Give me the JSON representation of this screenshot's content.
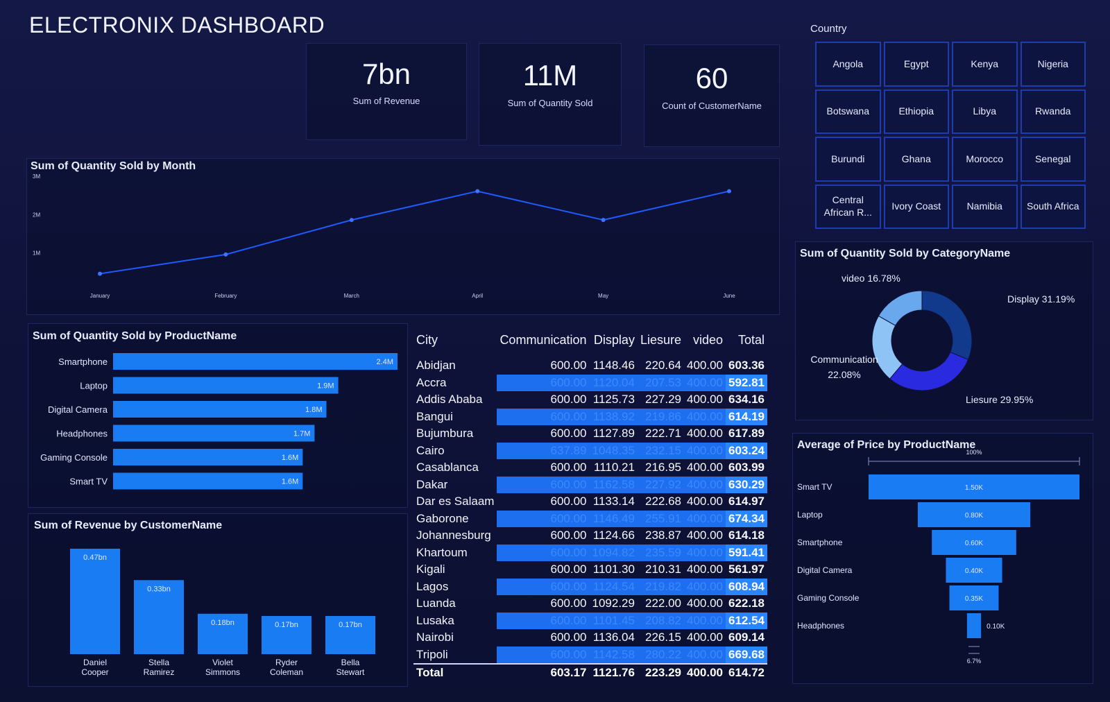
{
  "page": {
    "title": "ELECTRONIX DASHBOARD"
  },
  "kpis": [
    {
      "value": "7bn",
      "label": "Sum of Revenue"
    },
    {
      "value": "11M",
      "label": "Sum of Quantity Sold"
    },
    {
      "value": "60",
      "label": "Count of CustomerName"
    }
  ],
  "country_slicer": {
    "label": "Country",
    "items": [
      "Angola",
      "Egypt",
      "Kenya",
      "Nigeria",
      "Botswana",
      "Ethiopia",
      "Libya",
      "Rwanda",
      "Burundi",
      "Ghana",
      "Morocco",
      "Senegal",
      "Central African R...",
      "Ivory Coast",
      "Namibia",
      "South Africa"
    ]
  },
  "colors": {
    "accent": "#1e6ff0",
    "bar": "#1a7cf2",
    "line": "#1f5bff",
    "background": "#0e1238"
  },
  "line_chart": {
    "title": "Sum of Quantity Sold by Month",
    "chart_data": {
      "type": "line",
      "x": [
        "January",
        "February",
        "March",
        "April",
        "May",
        "June"
      ],
      "values": [
        0.55,
        1.05,
        1.95,
        2.7,
        1.95,
        2.7
      ],
      "ylim": [
        0,
        3
      ],
      "yticks": [
        "3M",
        "2M",
        "1M"
      ]
    }
  },
  "product_qty_chart": {
    "title": "Sum of Quantity Sold by ProductName",
    "chart_data": {
      "type": "bar",
      "categories": [
        "Smartphone",
        "Laptop",
        "Digital Camera",
        "Headphones",
        "Gaming Console",
        "Smart TV"
      ],
      "values": [
        2.4,
        1.9,
        1.8,
        1.7,
        1.6,
        1.6
      ],
      "labels": [
        "2.4M",
        "1.9M",
        "1.8M",
        "1.7M",
        "1.6M",
        "1.6M"
      ]
    }
  },
  "revenue_customer_chart": {
    "title": "Sum of Revenue by CustomerName",
    "chart_data": {
      "type": "bar",
      "categories": [
        "Daniel Cooper",
        "Stella Ramirez",
        "Violet Simmons",
        "Ryder Coleman",
        "Bella Stewart"
      ],
      "values": [
        0.47,
        0.33,
        0.18,
        0.17,
        0.17
      ],
      "labels": [
        "0.47bn",
        "0.33bn",
        "0.18bn",
        "0.17bn",
        "0.17bn"
      ]
    }
  },
  "table": {
    "headers": [
      "City",
      "Communication",
      "Display",
      "Liesure",
      "video",
      "Total"
    ],
    "rows": [
      [
        "Abidjan",
        "600.00",
        "1148.46",
        "220.64",
        "400.00",
        "603.36"
      ],
      [
        "Accra",
        "600.00",
        "1120.04",
        "207.53",
        "400.00",
        "592.81"
      ],
      [
        "Addis Ababa",
        "600.00",
        "1125.73",
        "227.29",
        "400.00",
        "634.16"
      ],
      [
        "Bangui",
        "600.00",
        "1138.92",
        "219.86",
        "400.00",
        "614.19"
      ],
      [
        "Bujumbura",
        "600.00",
        "1127.89",
        "222.71",
        "400.00",
        "617.89"
      ],
      [
        "Cairo",
        "637.89",
        "1048.35",
        "232.15",
        "400.00",
        "603.24"
      ],
      [
        "Casablanca",
        "600.00",
        "1110.21",
        "216.95",
        "400.00",
        "603.99"
      ],
      [
        "Dakar",
        "600.00",
        "1162.58",
        "227.92",
        "400.00",
        "630.29"
      ],
      [
        "Dar es Salaam",
        "600.00",
        "1133.14",
        "222.68",
        "400.00",
        "614.97"
      ],
      [
        "Gaborone",
        "600.00",
        "1146.49",
        "255.91",
        "400.00",
        "674.34"
      ],
      [
        "Johannesburg",
        "600.00",
        "1124.66",
        "238.87",
        "400.00",
        "614.18"
      ],
      [
        "Khartoum",
        "600.00",
        "1094.82",
        "235.59",
        "400.00",
        "591.41"
      ],
      [
        "Kigali",
        "600.00",
        "1101.30",
        "210.31",
        "400.00",
        "561.97"
      ],
      [
        "Lagos",
        "600.00",
        "1124.54",
        "219.82",
        "400.00",
        "608.94"
      ],
      [
        "Luanda",
        "600.00",
        "1092.29",
        "222.00",
        "400.00",
        "622.18"
      ],
      [
        "Lusaka",
        "600.00",
        "1101.45",
        "208.82",
        "400.00",
        "612.54"
      ],
      [
        "Nairobi",
        "600.00",
        "1136.04",
        "226.15",
        "400.00",
        "609.14"
      ],
      [
        "Tripoli",
        "600.00",
        "1142.58",
        "280.22",
        "400.00",
        "669.68"
      ]
    ],
    "total": [
      "Total",
      "603.17",
      "1121.76",
      "223.29",
      "400.00",
      "614.72"
    ]
  },
  "donut_chart": {
    "title": "Sum of Quantity Sold by CategoryName",
    "chart_data": {
      "type": "pie",
      "categories": [
        "Display",
        "Liesure",
        "Communication",
        "video"
      ],
      "values": [
        31.19,
        29.95,
        22.08,
        16.78
      ],
      "labels": [
        "Display 31.19%",
        "Liesure 29.95%",
        "Communication 22.08%",
        "video 16.78%"
      ],
      "colors": [
        "#123a8c",
        "#2a2ae0",
        "#8ec4f5",
        "#6aa8ee"
      ]
    }
  },
  "funnel_chart": {
    "title": "Average of Price by ProductName",
    "top_label": "100%",
    "bottom_label": "6.7%",
    "chart_data": {
      "type": "bar",
      "categories": [
        "Smart TV",
        "Laptop",
        "Smartphone",
        "Digital Camera",
        "Gaming Console",
        "Headphones"
      ],
      "values": [
        1.5,
        0.8,
        0.6,
        0.4,
        0.35,
        0.1
      ],
      "labels": [
        "1.50K",
        "0.80K",
        "0.60K",
        "0.40K",
        "0.35K",
        "0.10K"
      ]
    }
  }
}
